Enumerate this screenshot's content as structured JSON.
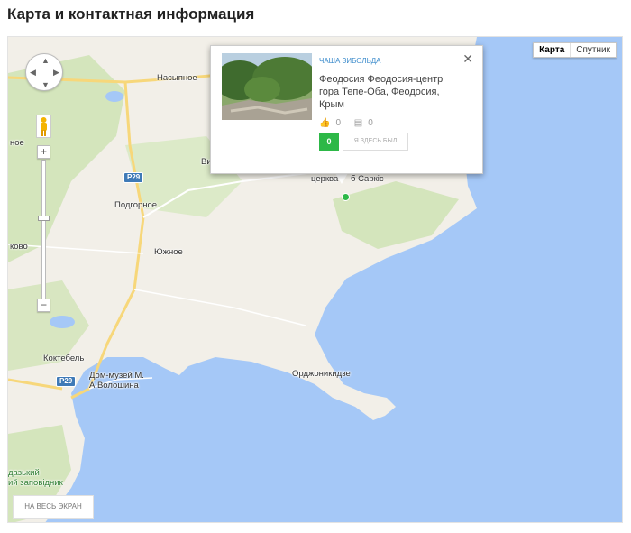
{
  "section": {
    "title": "Карта и контактная информация"
  },
  "map": {
    "type_control": {
      "map_label": "Карта",
      "satellite_label": "Спутник"
    },
    "labels": {
      "nasypnoe": "Насыпное",
      "noe": "ное",
      "vi": "Ви",
      "podgornoe": "Подгорное",
      "yuzhnoe": "Южное",
      "kovo": "ково",
      "koktebel": "Коктебель",
      "voloshin": "Дом-музей М.\nА Волошина",
      "ordzhonikidze": "Орджоникидзе",
      "church": "церква",
      "sarkis": "б Саркіс",
      "reserve": "дазький\nий заповідник"
    },
    "road_shields": {
      "p29_top": "P29",
      "p29_bottom": "P29"
    },
    "colors": {
      "water": "#a5c8f7",
      "land": "#f2efe8",
      "green_area": "#cfe3b4",
      "road": "#f7d77a",
      "marker": "#2db847"
    }
  },
  "popup": {
    "category": "ЧАША ЗИБОЛЬДА",
    "title": "Феодосия Феодосия-центр гора Тепе-Оба, Феодосия, Крым",
    "likes": "0",
    "comments": "0",
    "been_count": "0",
    "been_label": "Я ЗДЕСЬ БЫЛ",
    "close": "✕"
  },
  "fullscreen": {
    "label": "НА ВЕСЬ ЭКРАН"
  }
}
